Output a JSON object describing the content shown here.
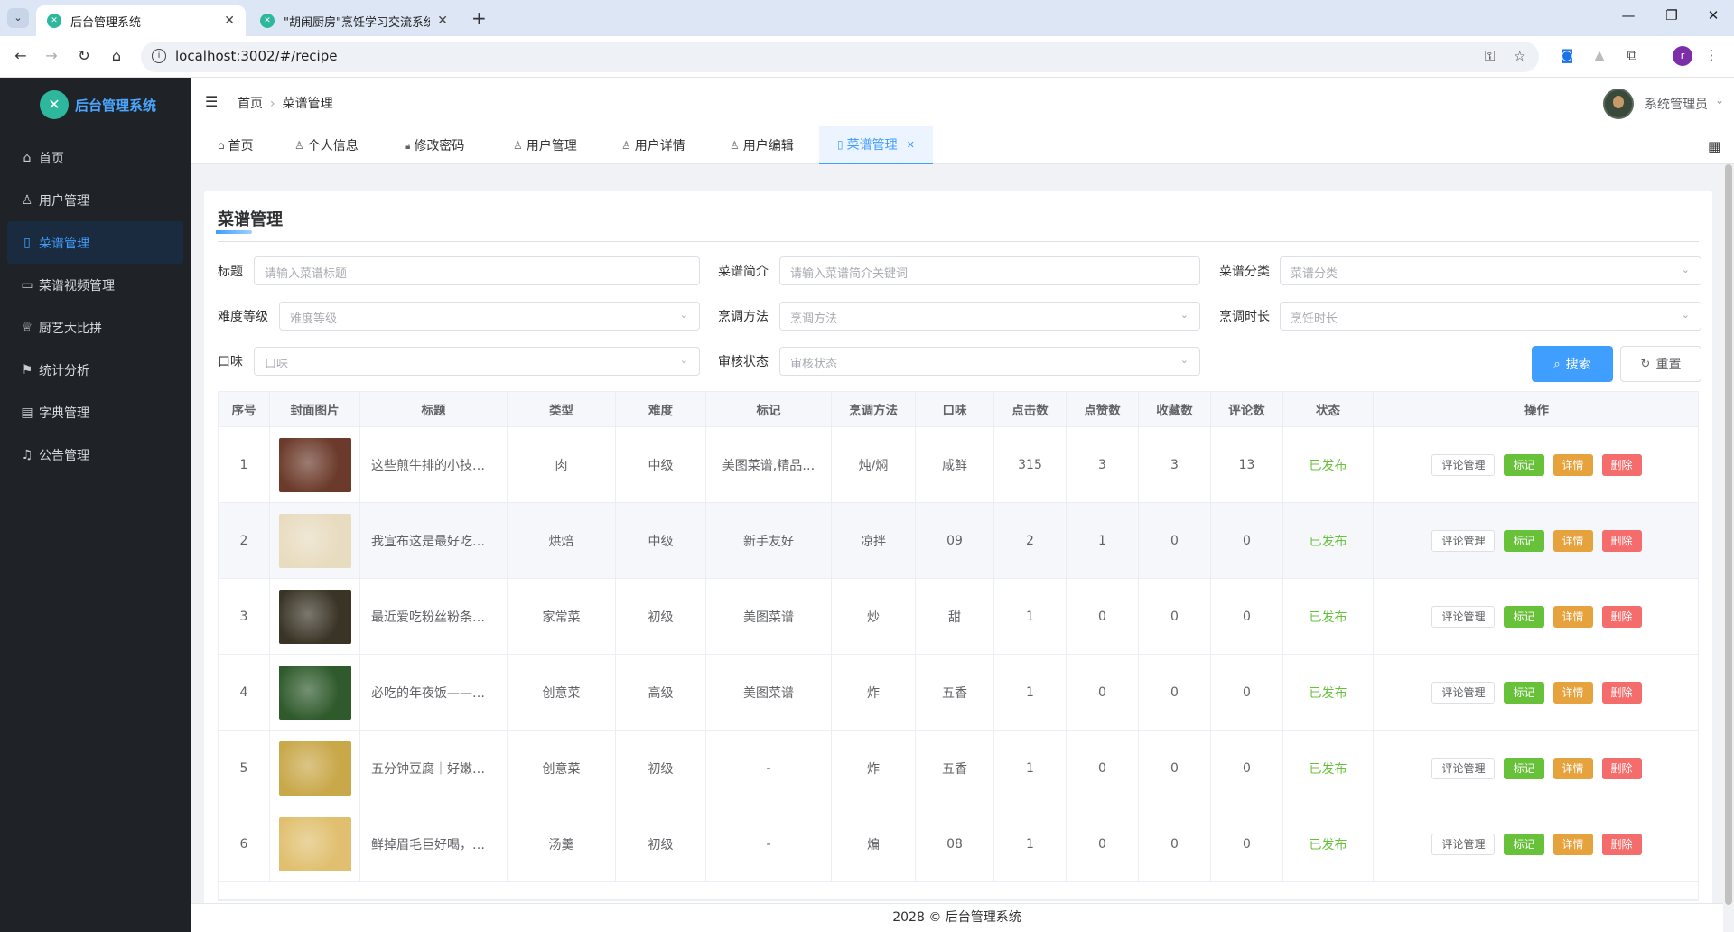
{
  "browser": {
    "tabs": [
      {
        "title": "后台管理系统",
        "active": true
      },
      {
        "title": "\"胡闹厨房\"烹饪学习交流系统",
        "active": false
      }
    ],
    "url": "localhost:3002/#/recipe",
    "profile_initial": "r"
  },
  "sidebar": {
    "brand": "后台管理系统",
    "items": [
      {
        "label": "首页",
        "icon": "home-icon"
      },
      {
        "label": "用户管理",
        "icon": "user-icon"
      },
      {
        "label": "菜谱管理",
        "icon": "document-icon",
        "active": true
      },
      {
        "label": "菜谱视频管理",
        "icon": "video-camera-icon"
      },
      {
        "label": "厨艺大比拼",
        "icon": "trophy-icon"
      },
      {
        "label": "统计分析",
        "icon": "flag-icon"
      },
      {
        "label": "字典管理",
        "icon": "notebook-icon"
      },
      {
        "label": "公告管理",
        "icon": "bell-icon"
      }
    ]
  },
  "header": {
    "breadcrumb": [
      "首页",
      "菜谱管理"
    ],
    "user_name": "系统管理员"
  },
  "tags": [
    {
      "label": "首页",
      "icon": "home-icon"
    },
    {
      "label": "个人信息",
      "icon": "user-icon"
    },
    {
      "label": "修改密码",
      "icon": "lock-icon"
    },
    {
      "label": "用户管理",
      "icon": "user-icon"
    },
    {
      "label": "用户详情",
      "icon": "user-icon"
    },
    {
      "label": "用户编辑",
      "icon": "user-icon"
    },
    {
      "label": "菜谱管理",
      "icon": "document-icon",
      "active": true
    }
  ],
  "page": {
    "title": "菜谱管理",
    "filters": {
      "title_label": "标题",
      "title_placeholder": "请输入菜谱标题",
      "intro_label": "菜谱简介",
      "intro_placeholder": "请输入菜谱简介关键词",
      "category_label": "菜谱分类",
      "category_placeholder": "菜谱分类",
      "difficulty_label": "难度等级",
      "difficulty_placeholder": "难度等级",
      "method_label": "烹调方法",
      "method_placeholder": "烹调方法",
      "duration_label": "烹调时长",
      "duration_placeholder": "烹饪时长",
      "taste_label": "口味",
      "taste_placeholder": "口味",
      "audit_label": "审核状态",
      "audit_placeholder": "审核状态"
    },
    "search_label": "搜索",
    "reset_label": "重置"
  },
  "table": {
    "columns": [
      "序号",
      "封面图片",
      "标题",
      "类型",
      "难度",
      "标记",
      "烹调方法",
      "口味",
      "点击数",
      "点赞数",
      "收藏数",
      "评论数",
      "状态",
      "操作"
    ],
    "actions": {
      "comment": "评论管理",
      "mark": "标记",
      "detail": "详情",
      "delete": "删除"
    },
    "rows": [
      {
        "idx": "1",
        "title": "这些煎牛排的小技…",
        "type": "肉",
        "difficulty": "中级",
        "tag": "美图菜谱,精品…",
        "method": "炖/焖",
        "taste": "咸鲜",
        "clicks": "315",
        "likes": "3",
        "favs": "3",
        "comments": "13",
        "status": "已发布",
        "img_color": "#6b3a2a"
      },
      {
        "idx": "2",
        "title": "我宣布这是最好吃…",
        "type": "烘焙",
        "difficulty": "中级",
        "tag": "新手友好",
        "method": "凉拌",
        "taste": "09",
        "clicks": "2",
        "likes": "1",
        "favs": "0",
        "comments": "0",
        "status": "已发布",
        "img_color": "#e8dcc0"
      },
      {
        "idx": "3",
        "title": "最近爱吃粉丝粉条…",
        "type": "家常菜",
        "difficulty": "初级",
        "tag": "美图菜谱",
        "method": "炒",
        "taste": "甜",
        "clicks": "1",
        "likes": "0",
        "favs": "0",
        "comments": "0",
        "status": "已发布",
        "img_color": "#3a3426"
      },
      {
        "idx": "4",
        "title": "必吃的年夜饭——…",
        "type": "创意菜",
        "difficulty": "高级",
        "tag": "美图菜谱",
        "method": "炸",
        "taste": "五香",
        "clicks": "1",
        "likes": "0",
        "favs": "0",
        "comments": "0",
        "status": "已发布",
        "img_color": "#2f5a2c"
      },
      {
        "idx": "5",
        "title": "五分钟豆腐｜好嫩…",
        "type": "创意菜",
        "difficulty": "初级",
        "tag": "-",
        "method": "炸",
        "taste": "五香",
        "clicks": "1",
        "likes": "0",
        "favs": "0",
        "comments": "0",
        "status": "已发布",
        "img_color": "#c9a84a"
      },
      {
        "idx": "6",
        "title": "鲜掉眉毛巨好喝，…",
        "type": "汤羹",
        "difficulty": "初级",
        "tag": "-",
        "method": "煸",
        "taste": "08",
        "clicks": "1",
        "likes": "0",
        "favs": "0",
        "comments": "0",
        "status": "已发布",
        "img_color": "#e0c070"
      }
    ]
  },
  "footer": "2028 © 后台管理系统"
}
